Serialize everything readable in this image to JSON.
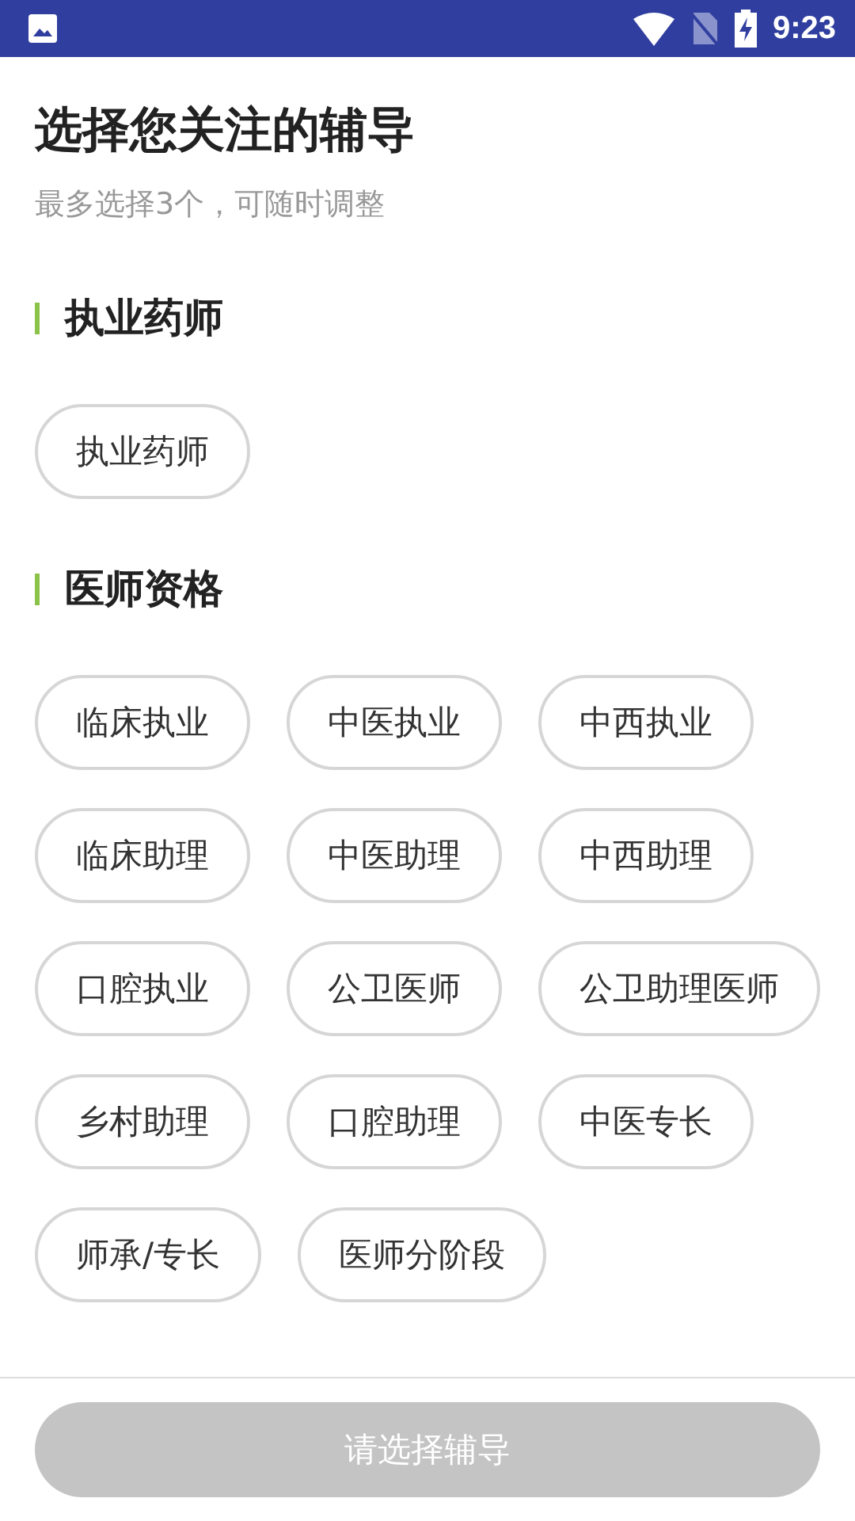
{
  "status_bar": {
    "time": "9:23"
  },
  "title": "选择您关注的辅导",
  "subtitle": "最多选择3个，可随时调整",
  "sections": [
    {
      "title": "执业药师",
      "chips": [
        {
          "label": "执业药师",
          "selected": false
        }
      ]
    },
    {
      "title": "医师资格",
      "chips": [
        {
          "label": "临床执业",
          "selected": false
        },
        {
          "label": "中医执业",
          "selected": false
        },
        {
          "label": "中西执业",
          "selected": false
        },
        {
          "label": "临床助理",
          "selected": false
        },
        {
          "label": "中医助理",
          "selected": false
        },
        {
          "label": "中西助理",
          "selected": false
        },
        {
          "label": "口腔执业",
          "selected": false
        },
        {
          "label": "公卫医师",
          "selected": false
        },
        {
          "label": "公卫助理医师",
          "selected": false
        },
        {
          "label": "乡村助理",
          "selected": false
        },
        {
          "label": "口腔助理",
          "selected": false
        },
        {
          "label": "中医专长",
          "selected": false
        },
        {
          "label": "师承/专长",
          "selected": false
        },
        {
          "label": "医师分阶段",
          "selected": false
        }
      ]
    }
  ],
  "confirm_button": {
    "label": "请选择辅导",
    "disabled": true
  }
}
